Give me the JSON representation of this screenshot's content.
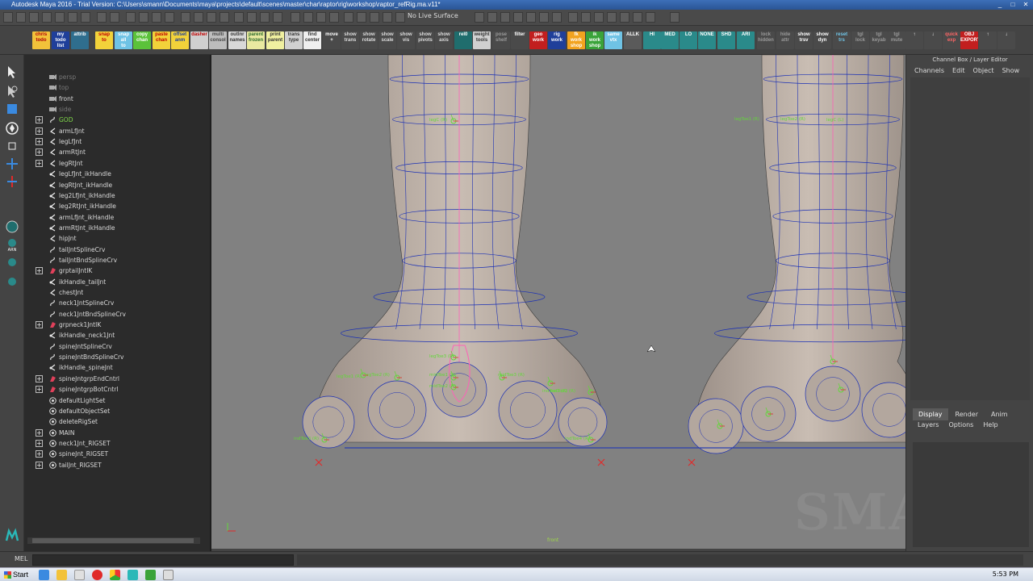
{
  "window": {
    "title": "Autodesk Maya 2016 - Trial Version: C:\\Users\\smann\\Documents\\maya\\projects\\default\\scenes\\master\\char\\raptor\\rig\\workshop\\raptor_refRig.ma.v11*",
    "minimize": "_",
    "maximize": "□",
    "close": "✕"
  },
  "statusline": {
    "live_surface": "No Live Surface"
  },
  "shelf": {
    "buttons": [
      {
        "label": "chris\ntodo",
        "bg": "#f2c23a",
        "fg": "#b0000a"
      },
      {
        "label": "my\ntodo\nlist",
        "bg": "#1f3f9a",
        "fg": "#ffffff"
      },
      {
        "label": "attrib",
        "bg": "#2f6e8e",
        "fg": "#ffffff"
      },
      {
        "label": "snap\nto",
        "bg": "#f2d23a",
        "fg": "#c00000"
      },
      {
        "label": "snap\nall\nto",
        "bg": "#6fc3e5",
        "fg": "#ffffff"
      },
      {
        "label": "copy\nchan",
        "bg": "#5bc23a",
        "fg": "#ffffff"
      },
      {
        "label": "paste\nchan",
        "bg": "#f2d23a",
        "fg": "#c00000"
      },
      {
        "label": "offset\nanm",
        "bg": "#f2d23a",
        "fg": "#1f3f9a"
      },
      {
        "label": "dasher",
        "bg": "#cfcfcf",
        "fg": "#c00000"
      },
      {
        "label": "multi\nconsol",
        "bg": "#bdbdbd",
        "fg": "#444444"
      },
      {
        "label": "outlnr\nnames",
        "bg": "#d8d8d8",
        "fg": "#333333"
      },
      {
        "label": "parent\nfrozen",
        "bg": "#e9e9a0",
        "fg": "#2a6a2a"
      },
      {
        "label": "print\nparent",
        "bg": "#f0f0a0",
        "fg": "#333333"
      },
      {
        "label": "trans\ntype",
        "bg": "#d0d0d0",
        "fg": "#333333"
      },
      {
        "label": "find\ncenter",
        "bg": "#efefef",
        "fg": "#333333"
      },
      {
        "label": "move\n+",
        "bg": "#4a4a4a",
        "fg": "#ffffff"
      },
      {
        "label": "show\ntrans",
        "bg": "#4a4a4a",
        "fg": "#dddddd"
      },
      {
        "label": "show\nrotate",
        "bg": "#4a4a4a",
        "fg": "#dddddd"
      },
      {
        "label": "show\nscale",
        "bg": "#4a4a4a",
        "fg": "#dddddd"
      },
      {
        "label": "show\nvis",
        "bg": "#4a4a4a",
        "fg": "#dddddd"
      },
      {
        "label": "show\npivots",
        "bg": "#4a4a4a",
        "fg": "#dddddd"
      },
      {
        "label": "show\naxis",
        "bg": "#4a4a4a",
        "fg": "#dddddd"
      },
      {
        "label": "rel0",
        "bg": "#1f6d6d",
        "fg": "#ffffff"
      },
      {
        "label": "weight\ntools",
        "bg": "#d0d0d0",
        "fg": "#333333"
      },
      {
        "label": "pose\nshelf",
        "bg": "#4a4a4a",
        "fg": "#999999"
      },
      {
        "label": "filter",
        "bg": "#4a4a4a",
        "fg": "#ffffff"
      },
      {
        "label": "geo\nwork",
        "bg": "#c21f1f",
        "fg": "#ffffff"
      },
      {
        "label": "rig\nwork",
        "bg": "#1f3f9a",
        "fg": "#ffffff"
      },
      {
        "label": "fk\nwork\nshop",
        "bg": "#f2a31f",
        "fg": "#ffffff"
      },
      {
        "label": "ik\nwork\nshop",
        "bg": "#3aa33a",
        "fg": "#ffffff"
      },
      {
        "label": "same\nvtx",
        "bg": "#6fc3e5",
        "fg": "#ffffff"
      },
      {
        "label": "ALLK",
        "bg": "#5a5a5a",
        "fg": "#ffffff"
      },
      {
        "label": "HI",
        "bg": "#2a8a8a",
        "fg": "#ffffff"
      },
      {
        "label": "MED",
        "bg": "#2a8a8a",
        "fg": "#ffffff"
      },
      {
        "label": "LO",
        "bg": "#2a8a8a",
        "fg": "#ffffff"
      },
      {
        "label": "NONE",
        "bg": "#2a8a8a",
        "fg": "#ffffff"
      },
      {
        "label": "SHD",
        "bg": "#2a8a8a",
        "fg": "#ffffff"
      },
      {
        "label": "ARI",
        "bg": "#2a8a8a",
        "fg": "#ffffff"
      },
      {
        "label": "lock\nhidden",
        "bg": "#4a4a4a",
        "fg": "#999999"
      },
      {
        "label": "hide\nattr",
        "bg": "#4a4a4a",
        "fg": "#999999"
      },
      {
        "label": "show\ntrsv",
        "bg": "#4a4a4a",
        "fg": "#ffffff"
      },
      {
        "label": "show\ndyn",
        "bg": "#4a4a4a",
        "fg": "#ffffff"
      },
      {
        "label": "reset\ntrs",
        "bg": "#4a4a4a",
        "fg": "#6fc3e5"
      },
      {
        "label": "tgl\nlock",
        "bg": "#4a4a4a",
        "fg": "#999999"
      },
      {
        "label": "tgl\nkeyab",
        "bg": "#4a4a4a",
        "fg": "#999999"
      },
      {
        "label": "tgl\nmute",
        "bg": "#4a4a4a",
        "fg": "#999999"
      },
      {
        "label": "↑",
        "bg": "#4a4a4a",
        "fg": "#ffffff"
      },
      {
        "label": "↓",
        "bg": "#4a4a4a",
        "fg": "#ffffff"
      },
      {
        "label": "quick\nexp",
        "bg": "#4a4a4a",
        "fg": "#ff6666"
      },
      {
        "label": "OBJ\nEXPORT",
        "bg": "#c21f1f",
        "fg": "#ffffff"
      },
      {
        "label": "↑",
        "bg": "#4a4a4a",
        "fg": "#ffffff"
      },
      {
        "label": "↓",
        "bg": "#4a4a4a",
        "fg": "#ffffff"
      }
    ]
  },
  "outliner": {
    "items": [
      {
        "label": "persp",
        "expand": "",
        "icon": "camera",
        "dim": true
      },
      {
        "label": "top",
        "expand": "",
        "icon": "camera",
        "dim": true
      },
      {
        "label": "front",
        "expand": "",
        "icon": "camera",
        "dim": false
      },
      {
        "label": "side",
        "expand": "",
        "icon": "camera",
        "dim": true
      },
      {
        "label": "GOD",
        "expand": "+",
        "icon": "curve",
        "green": true
      },
      {
        "label": "armLfJnt",
        "expand": "+",
        "icon": "joint"
      },
      {
        "label": "legLfJnt",
        "expand": "+",
        "icon": "joint"
      },
      {
        "label": "armRtJnt",
        "expand": "+",
        "icon": "joint"
      },
      {
        "label": "legRtJnt",
        "expand": "+",
        "icon": "joint"
      },
      {
        "label": "legLfJnt_ikHandle",
        "expand": "",
        "icon": "ikhandle"
      },
      {
        "label": "legRtJnt_ikHandle",
        "expand": "",
        "icon": "ikhandle"
      },
      {
        "label": "leg2LfJnt_ikHandle",
        "expand": "",
        "icon": "ikhandle"
      },
      {
        "label": "leg2RtJnt_ikHandle",
        "expand": "",
        "icon": "ikhandle"
      },
      {
        "label": "armLfJnt_ikHandle",
        "expand": "",
        "icon": "ikhandle"
      },
      {
        "label": "armRtJnt_ikHandle",
        "expand": "",
        "icon": "ikhandle"
      },
      {
        "label": "hipJnt",
        "expand": "",
        "icon": "joint"
      },
      {
        "label": "tailJntSplineCrv",
        "expand": "",
        "icon": "curve"
      },
      {
        "label": "tailJntBndSplineCrv",
        "expand": "",
        "icon": "curve"
      },
      {
        "label": "grptailJntIK",
        "expand": "+",
        "icon": "group"
      },
      {
        "label": "ikHandle_tailJnt",
        "expand": "",
        "icon": "ikhandle"
      },
      {
        "label": "chestJnt",
        "expand": "",
        "icon": "joint"
      },
      {
        "label": "neck1JntSplineCrv",
        "expand": "",
        "icon": "curve"
      },
      {
        "label": "neck1JntBndSplineCrv",
        "expand": "",
        "icon": "curve"
      },
      {
        "label": "grpneck1JntIK",
        "expand": "+",
        "icon": "group"
      },
      {
        "label": "ikHandle_neck1Jnt",
        "expand": "",
        "icon": "ikhandle"
      },
      {
        "label": "spineJntSplineCrv",
        "expand": "",
        "icon": "curve"
      },
      {
        "label": "spineJntBndSplineCrv",
        "expand": "",
        "icon": "curve"
      },
      {
        "label": "ikHandle_spineJnt",
        "expand": "",
        "icon": "ikhandle"
      },
      {
        "label": "spineJntgrpEndCntrl",
        "expand": "+",
        "icon": "group"
      },
      {
        "label": "spineJntgrpBotCntrl",
        "expand": "+",
        "icon": "group"
      },
      {
        "label": "defaultLightSet",
        "expand": "",
        "icon": "set"
      },
      {
        "label": "defaultObjectSet",
        "expand": "",
        "icon": "set"
      },
      {
        "label": "deleteRigSet",
        "expand": "",
        "icon": "set"
      },
      {
        "label": "MAIN",
        "expand": "+",
        "icon": "set"
      },
      {
        "label": "neck1Jnt_RIGSET",
        "expand": "+",
        "icon": "set"
      },
      {
        "label": "spineJnt_RIGSET",
        "expand": "+",
        "icon": "set"
      },
      {
        "label": "tailJnt_RIGSET",
        "expand": "+",
        "icon": "set"
      }
    ]
  },
  "viewport": {
    "camera": "front",
    "watermark": "SMANN",
    "joint_labels": [
      "legC (R)",
      "legToe1 (R)",
      "legToe2 (R)",
      "legToe3 (R)",
      "midToe1 (R)",
      "midToe2 (R)",
      "midToe3 (R)",
      "indToe1 (R)",
      "indToe2 (R)",
      "indToe3 (R)",
      "indToe4 (R)",
      "legToe1 (R)",
      "legToe2 (R)",
      "legC (L)"
    ]
  },
  "channelbox": {
    "title": "Channel Box / Layer Editor",
    "menu": [
      "Channels",
      "Edit",
      "Object",
      "Show"
    ]
  },
  "layereditor": {
    "tabs": [
      "Display",
      "Render",
      "Anim"
    ],
    "active_tab": "Display",
    "menu": [
      "Layers",
      "Options",
      "Help"
    ]
  },
  "cmdline": {
    "label": "MEL"
  },
  "taskbar": {
    "start": "Start",
    "clock": "5:53 PM"
  },
  "colors": {
    "viewport_bg": "#818181",
    "wire": "#1a2fb5",
    "joint_green": "#63d63a",
    "joint_red": "#e02a2a",
    "selection_pink": "#ff5fb8"
  }
}
